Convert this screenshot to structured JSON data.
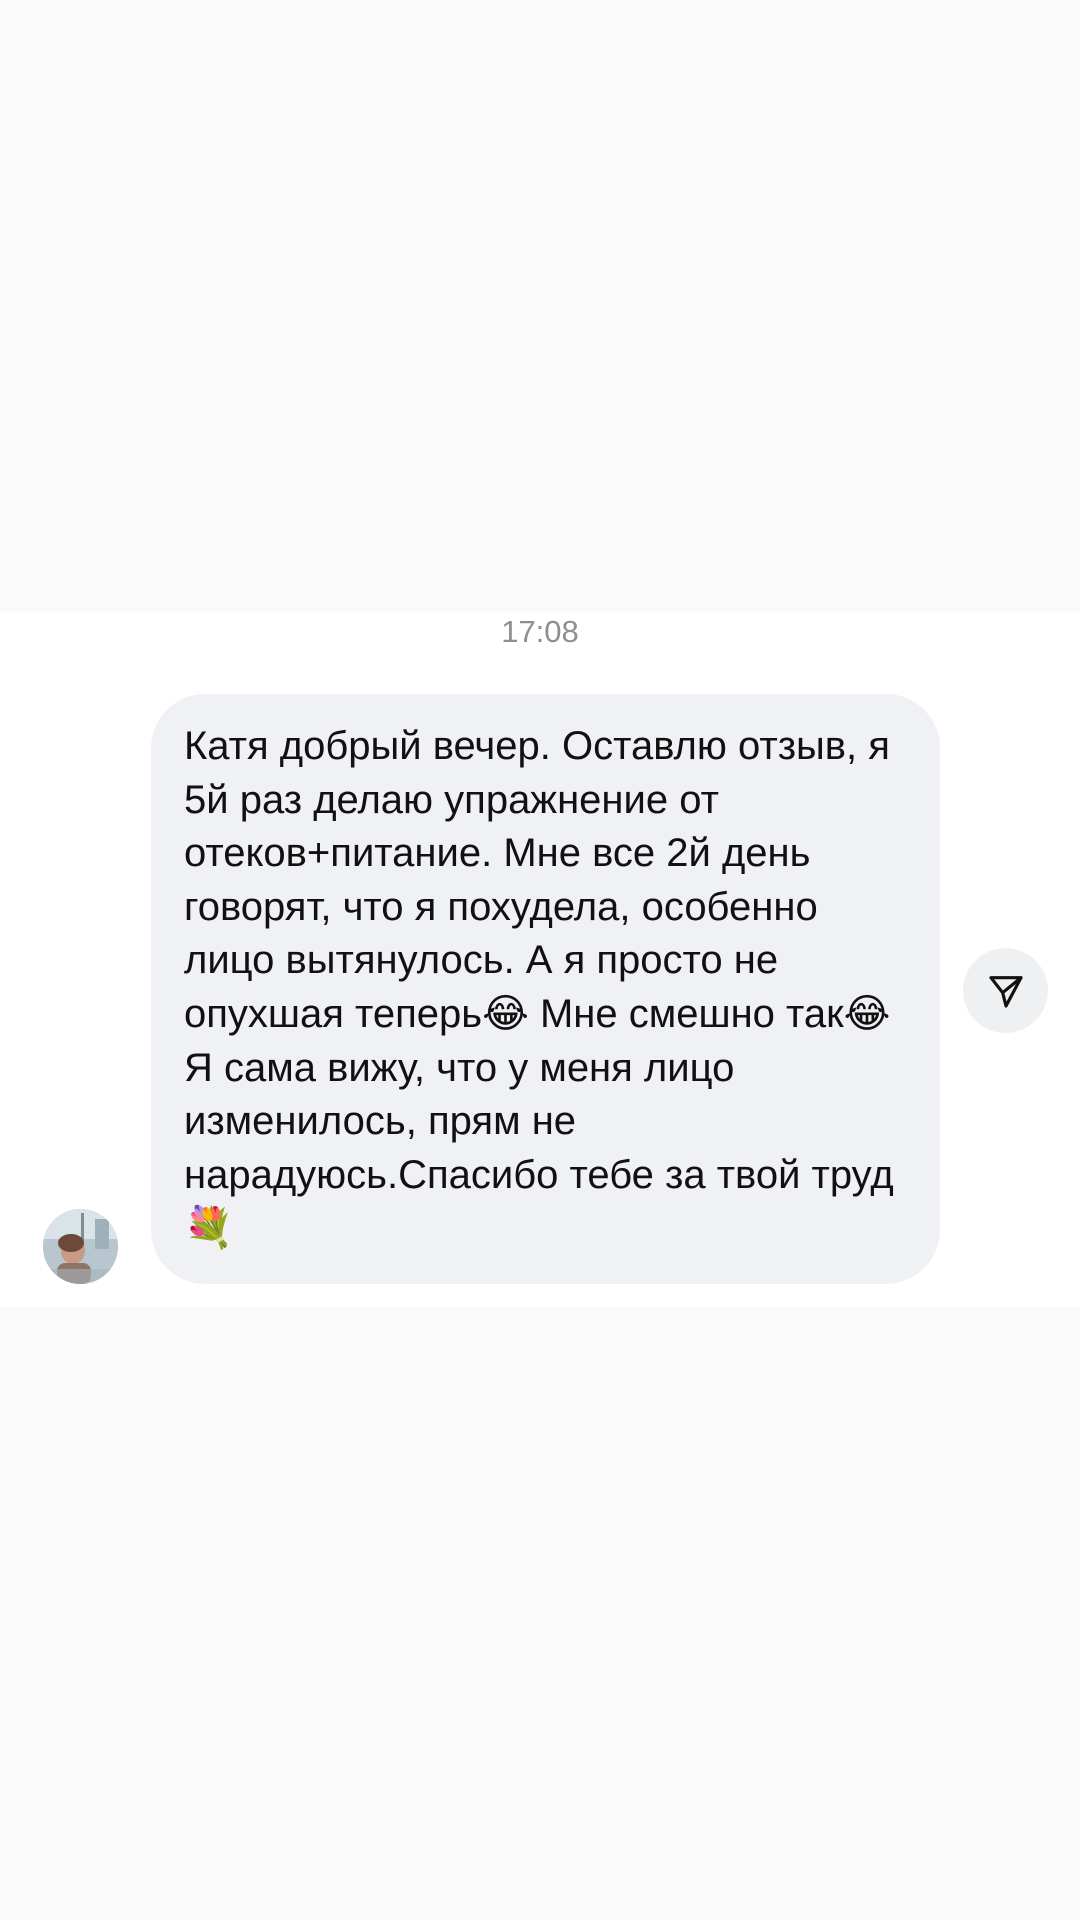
{
  "chat": {
    "timestamp": "17:08",
    "message": {
      "text": "Катя добрый вечер. Оставлю отзыв, я 5й раз делаю упражнение от отеков+питание. Мне все 2й день говорят, что я похудела, особенно лицо вытянулось. А я просто не опухшая теперь😂 Мне смешно так😂 Я сама вижу, что у меня лицо изменилось, прям не нарадуюсь.Спасибо тебе за твой труд 💐"
    },
    "sender_avatar_icon": "user-avatar-photo",
    "share_icon": "paper-plane-icon"
  },
  "colors": {
    "background": "#fafafa",
    "chat_band": "#ffffff",
    "bubble": "#f0f1f5",
    "timestamp_text": "#8e8e93",
    "message_text": "#111111"
  }
}
